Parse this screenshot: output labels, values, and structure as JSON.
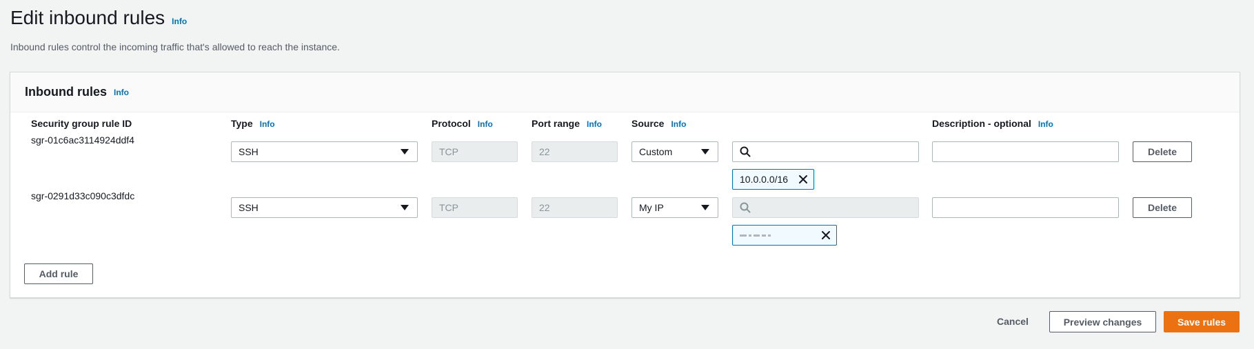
{
  "page": {
    "title": "Edit inbound rules",
    "info": "Info",
    "description": "Inbound rules control the incoming traffic that's allowed to reach the instance."
  },
  "panel": {
    "title": "Inbound rules",
    "info": "Info",
    "columns": {
      "rule_id": "Security group rule ID",
      "type": "Type",
      "protocol": "Protocol",
      "port_range": "Port range",
      "source": "Source",
      "description": "Description - optional",
      "info": "Info"
    },
    "rules": [
      {
        "id": "sgr-01c6ac3114924ddf4",
        "type": "SSH",
        "protocol": "TCP",
        "port_range": "22",
        "source": "Custom",
        "search_value": "",
        "token": "10.0.0.0/16",
        "description": "",
        "delete_label": "Delete"
      },
      {
        "id": "sgr-0291d33c090c3dfdc",
        "type": "SSH",
        "protocol": "TCP",
        "port_range": "22",
        "source": "My IP",
        "search_value": "",
        "token": "",
        "description": "",
        "delete_label": "Delete"
      }
    ],
    "add_rule_label": "Add rule"
  },
  "footer": {
    "cancel_label": "Cancel",
    "preview_label": "Preview changes",
    "save_label": "Save rules"
  },
  "colors": {
    "accent": "#0073bb",
    "primary_button": "#ec7211",
    "background": "#f2f3f3"
  },
  "icons": {
    "search": "search-icon",
    "dismiss": "close-icon",
    "dropdown": "caret-down-icon"
  }
}
